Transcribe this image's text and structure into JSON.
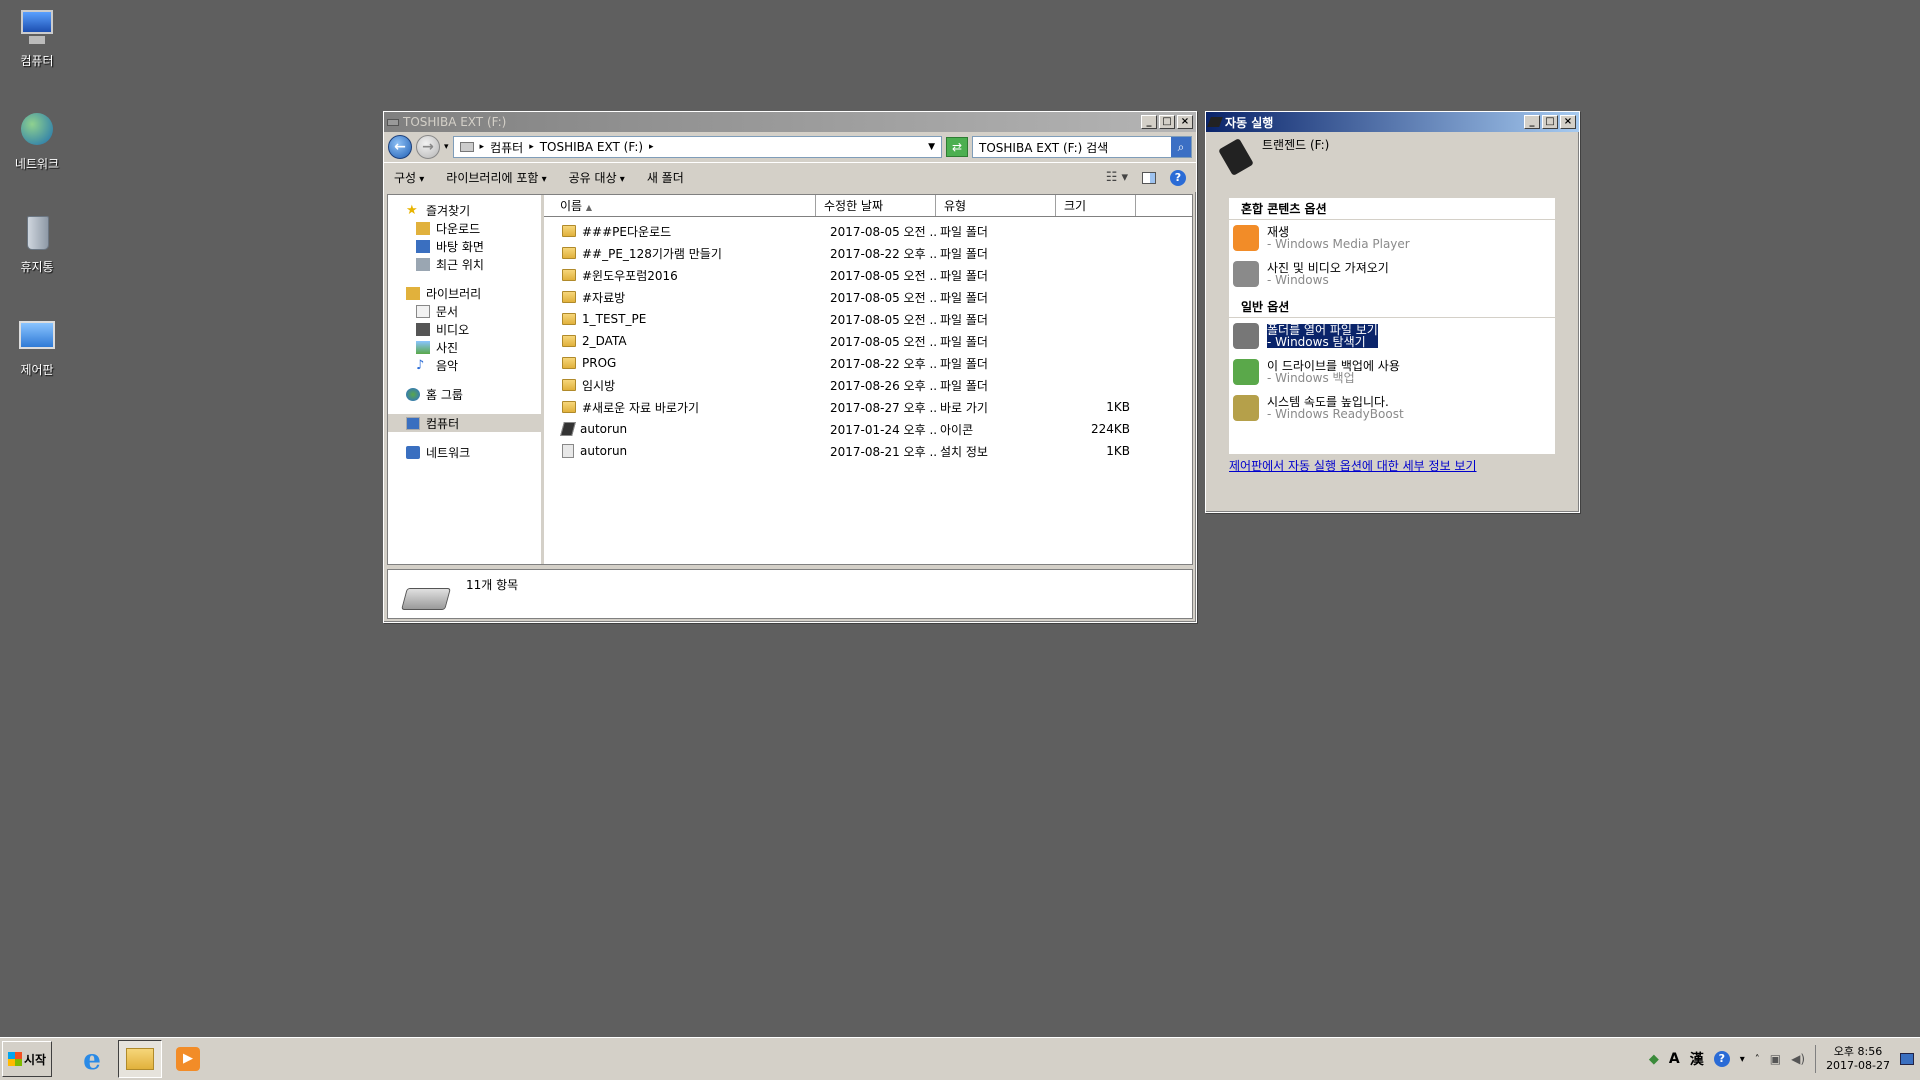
{
  "desktop": {
    "icons": [
      {
        "label": "컴퓨터"
      },
      {
        "label": "네트워크"
      },
      {
        "label": "휴지통"
      },
      {
        "label": "제어판"
      }
    ]
  },
  "explorer": {
    "title": "TOSHIBA EXT (F:)",
    "address": {
      "crumb1": "컴퓨터",
      "crumb2": "TOSHIBA EXT (F:)"
    },
    "search_placeholder": "TOSHIBA EXT (F:) 검색",
    "commands": {
      "organize": "구성",
      "include_library": "라이브러리에 포함",
      "share": "공유 대상",
      "new_folder": "새 폴더"
    },
    "nav": {
      "favorites": "즐겨찾기",
      "downloads": "다운로드",
      "desktop": "바탕 화면",
      "recent": "최근 위치",
      "libraries": "라이브러리",
      "documents": "문서",
      "videos": "비디오",
      "pictures": "사진",
      "music": "음악",
      "homegroup": "홈 그룹",
      "computer": "컴퓨터",
      "network": "네트워크"
    },
    "columns": {
      "name": "이름",
      "modified": "수정한 날짜",
      "type": "유형",
      "size": "크기"
    },
    "files": [
      {
        "name": "###PE다운로드",
        "modified": "2017-08-05 오전 ...",
        "type": "파일 폴더",
        "size": "",
        "icon": "folder"
      },
      {
        "name": "##_PE_128기가램 만들기",
        "modified": "2017-08-22 오후 ...",
        "type": "파일 폴더",
        "size": "",
        "icon": "folder"
      },
      {
        "name": "#윈도우포럼2016",
        "modified": "2017-08-05 오전 ...",
        "type": "파일 폴더",
        "size": "",
        "icon": "folder"
      },
      {
        "name": "#자료방",
        "modified": "2017-08-05 오전 ...",
        "type": "파일 폴더",
        "size": "",
        "icon": "folder"
      },
      {
        "name": "1_TEST_PE",
        "modified": "2017-08-05 오전 ...",
        "type": "파일 폴더",
        "size": "",
        "icon": "folder"
      },
      {
        "name": "2_DATA",
        "modified": "2017-08-05 오전 ...",
        "type": "파일 폴더",
        "size": "",
        "icon": "folder"
      },
      {
        "name": "PROG",
        "modified": "2017-08-22 오후 ...",
        "type": "파일 폴더",
        "size": "",
        "icon": "folder"
      },
      {
        "name": "임시방",
        "modified": "2017-08-26 오후 ...",
        "type": "파일 폴더",
        "size": "",
        "icon": "folder"
      },
      {
        "name": "#새로운 자료 바로가기",
        "modified": "2017-08-27 오후 ...",
        "type": "바로 가기",
        "size": "1KB",
        "icon": "folder"
      },
      {
        "name": "autorun",
        "modified": "2017-01-24 오후 ...",
        "type": "아이콘",
        "size": "224KB",
        "icon": "icon-file"
      },
      {
        "name": "autorun",
        "modified": "2017-08-21 오후 ...",
        "type": "설치 정보",
        "size": "1KB",
        "icon": "setup-file"
      }
    ],
    "status": "11개 항목"
  },
  "autoplay": {
    "title": "자동 실행",
    "device": "트랜젠드 (F:)",
    "section_mixed": "혼합 콘텐츠 옵션",
    "section_general": "일반 옵션",
    "items": [
      {
        "label": "재생",
        "sub": "- Windows Media Player",
        "icon_color": "#f28c28"
      },
      {
        "label": "사진 및 비디오 가져오기",
        "sub": "- Windows",
        "icon_color": "#8a8a8a"
      },
      {
        "label": "폴더를 열어 파일 보기",
        "sub": "- Windows 탐색기",
        "icon_color": "#777777"
      },
      {
        "label": "이 드라이브를 백업에 사용",
        "sub": "- Windows 백업",
        "icon_color": "#5aa84a"
      },
      {
        "label": "시스템 속도를 높입니다.",
        "sub": "- Windows ReadyBoost",
        "icon_color": "#b5a04a"
      }
    ],
    "link": "제어판에서 자동 실행 옵션에 대한 세부 정보 보기"
  },
  "taskbar": {
    "start": "시작",
    "ime_a": "A",
    "ime_han": "漢",
    "clock_time": "오후 8:56",
    "clock_date": "2017-08-27"
  }
}
